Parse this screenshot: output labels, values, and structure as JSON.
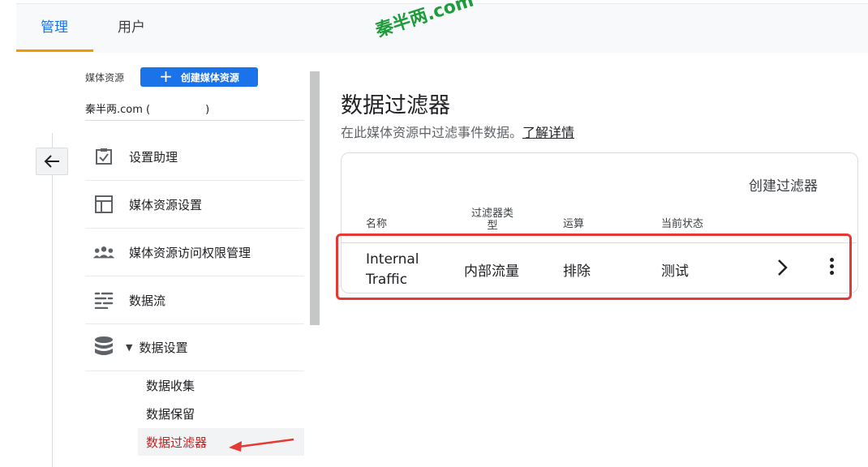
{
  "tabs": [
    {
      "label": "管理",
      "active": true
    },
    {
      "label": "用户",
      "active": false
    }
  ],
  "watermark": "秦半两.com",
  "sidebar": {
    "resource_label": "媒体资源",
    "create_resource_label": "创建媒体资源",
    "property_name": "秦半两.com (",
    "property_suffix": ")",
    "items": [
      {
        "label": "设置助理",
        "icon": "checklist-icon"
      },
      {
        "label": "媒体资源设置",
        "icon": "layout-icon"
      },
      {
        "label": "媒体资源访问权限管理",
        "icon": "people-icon"
      },
      {
        "label": "数据流",
        "icon": "streams-icon"
      },
      {
        "label": "数据设置",
        "icon": "database-icon",
        "expanded": true
      }
    ],
    "sub_items": [
      {
        "label": "数据收集"
      },
      {
        "label": "数据保留"
      },
      {
        "label": "数据过滤器",
        "active": true
      }
    ]
  },
  "main": {
    "title": "数据过滤器",
    "subtitle": "在此媒体资源中过滤事件数据。",
    "learn_more": "了解详情",
    "create_filter": "创建过滤器",
    "columns": [
      "名称",
      "过滤器类型",
      "运算",
      "当前状态"
    ],
    "rows": [
      {
        "name_line1": "Internal",
        "name_line2": "Traffic",
        "type": "内部流量",
        "operation": "排除",
        "status": "测试"
      }
    ]
  },
  "colors": {
    "accent": "#1a73e8",
    "tab_underline": "#f29900",
    "highlight": "#e53935",
    "watermark": "#1e9b3a"
  }
}
